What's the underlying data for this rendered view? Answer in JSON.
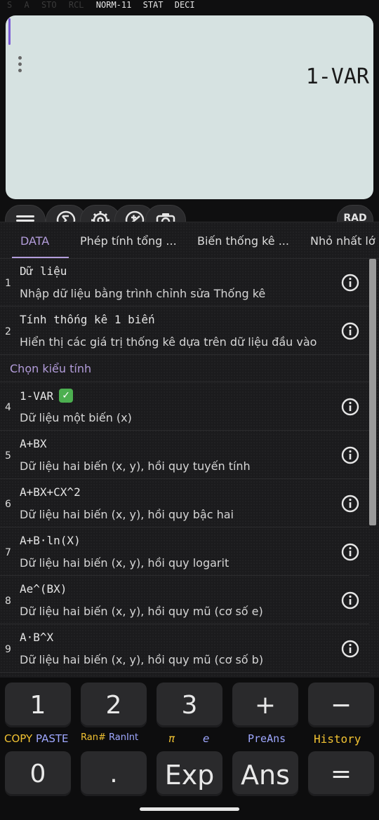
{
  "status_bar": {
    "inactive": [
      "S",
      "A",
      "STO",
      "RCL"
    ],
    "active": [
      "NORM-11",
      "STAT",
      "DECI"
    ]
  },
  "display": {
    "result": "1-VAR"
  },
  "toolbar": {
    "buttons": [
      "menu-icon",
      "sigma-icon",
      "gear-icon",
      "plus-minus-icon",
      "camera-icon"
    ],
    "mode_label": "RAD"
  },
  "tabs": [
    "DATA",
    "Phép tính tổng ...",
    "Biến thống kê ...",
    "Nhỏ nhất lớ"
  ],
  "list": {
    "items": [
      {
        "num": "1",
        "title": "Dữ liệu",
        "sub": "Nhập dữ liệu bằng trình chỉnh sửa Thống kê"
      },
      {
        "num": "2",
        "title": "Tính thống kê 1 biến",
        "sub": "Hiển thị các giá trị thống kê dựa trên dữ liệu đầu vào"
      }
    ],
    "section_header": "Chọn kiểu tính",
    "items2": [
      {
        "num": "4",
        "title": "1-VAR",
        "sub": "Dữ liệu một biến (x)",
        "selected": true
      },
      {
        "num": "5",
        "title": "A+BX",
        "sub": "Dữ liệu hai biến (x, y), hồi quy tuyến tính"
      },
      {
        "num": "6",
        "title": "A+BX+CX^2",
        "sub": "Dữ liệu hai biến (x, y), hồi quy bậc hai"
      },
      {
        "num": "7",
        "title": "A+B·ln(X)",
        "sub": "Dữ liệu hai biến (x, y), hồi quy logarit"
      },
      {
        "num": "8",
        "title": "Ae^(BX)",
        "sub": "Dữ liệu hai biến (x, y), hồi quy mũ (cơ số e)"
      },
      {
        "num": "9",
        "title": "A·B^X",
        "sub": "Dữ liệu hai biến (x, y), hồi quy mũ (cơ số b)"
      }
    ]
  },
  "keypad": {
    "row1": [
      "1",
      "2",
      "3",
      "+",
      "−"
    ],
    "shift_labels": {
      "k0_a": "COPY",
      "k0_b": "PASTE",
      "k1_a": "Ran#",
      "k1_b": "RanInt",
      "k2_a": "π",
      "k2_b": "e",
      "k3": "PreAns",
      "k4": "History"
    },
    "row2": [
      "0",
      ".",
      "Exp",
      "Ans",
      "="
    ]
  },
  "colors": {
    "accent": "#b39ddb",
    "shift_yellow": "#f1c232",
    "shift_blue": "#9fa8ff",
    "display_bg": "#d6e2e1"
  }
}
